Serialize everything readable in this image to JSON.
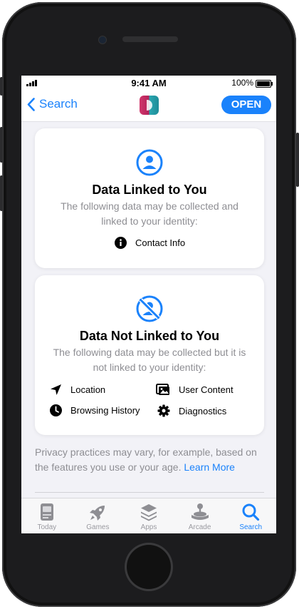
{
  "status_bar": {
    "time": "9:41 AM",
    "battery": "100%"
  },
  "nav": {
    "back_label": "Search",
    "open_label": "OPEN"
  },
  "linked": {
    "title": "Data Linked to You",
    "description": "The following data may be collected and linked to your identity:",
    "items": [
      {
        "icon": "info-icon",
        "label": "Contact Info"
      }
    ]
  },
  "not_linked": {
    "title": "Data Not Linked to You",
    "description": "The following data may be collected but it is not linked to your identity:",
    "items": [
      {
        "icon": "location-icon",
        "label": "Location"
      },
      {
        "icon": "user-content-icon",
        "label": "User Content"
      },
      {
        "icon": "clock-icon",
        "label": "Browsing History"
      },
      {
        "icon": "gear-icon",
        "label": "Diagnostics"
      }
    ]
  },
  "footer": {
    "text": "Privacy practices may vary, for example, based on the features you use or your age.",
    "link": "Learn More"
  },
  "tabs": [
    {
      "label": "Today",
      "icon": "today-icon",
      "active": false
    },
    {
      "label": "Games",
      "icon": "rocket-icon",
      "active": false
    },
    {
      "label": "Apps",
      "icon": "layers-icon",
      "active": false
    },
    {
      "label": "Arcade",
      "icon": "joystick-icon",
      "active": false
    },
    {
      "label": "Search",
      "icon": "search-icon",
      "active": true
    }
  ],
  "colors": {
    "accent": "#1a82fb",
    "secondary_text": "#8e8e93",
    "background": "#f2f2f7"
  }
}
